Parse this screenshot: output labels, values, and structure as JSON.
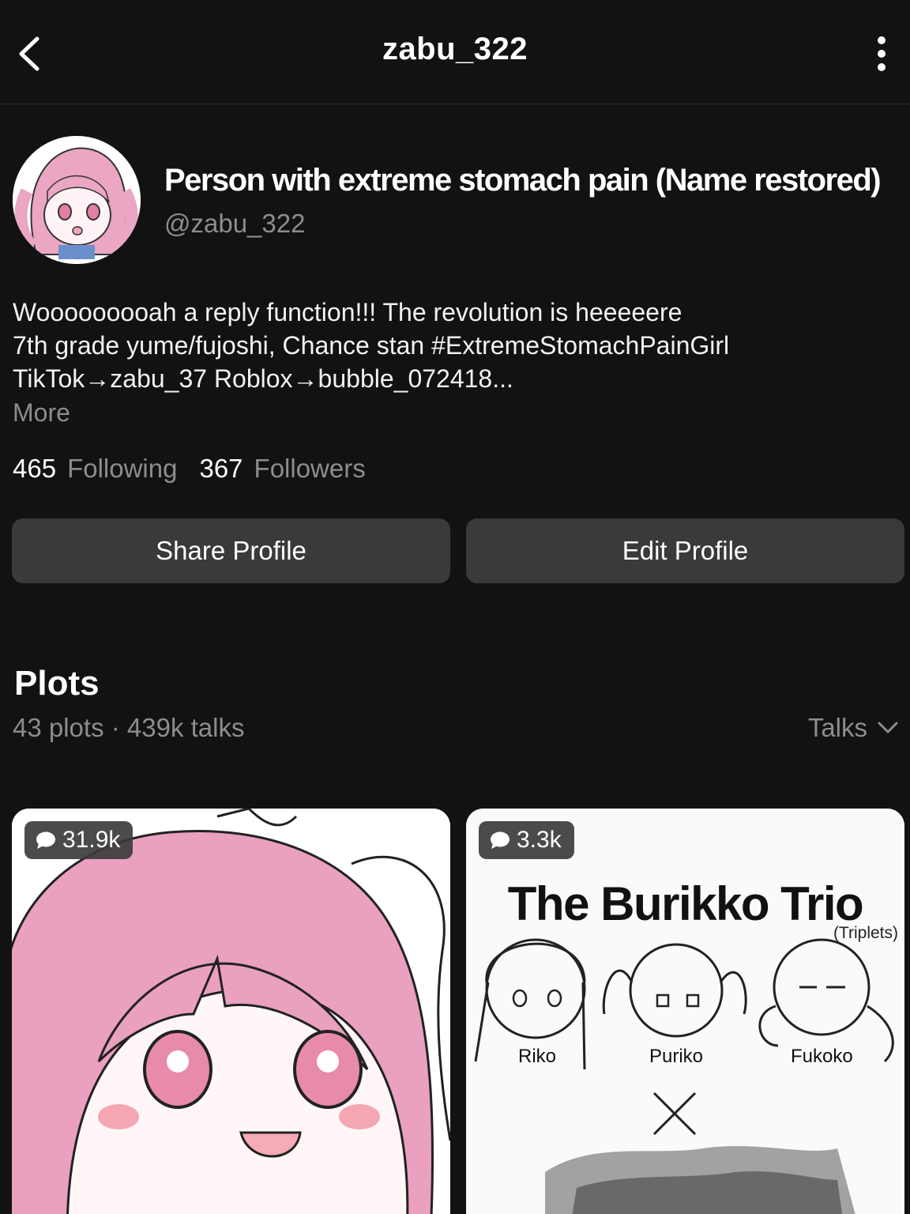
{
  "header": {
    "title": "zabu_322"
  },
  "profile": {
    "display_name": "Person with extreme stomach pain (Name restored)",
    "handle": "@zabu_322",
    "bio_lines": [
      "Wooooooooah a reply function!!! The revolution is heeeeere",
      "7th grade yume/fujoshi, Chance stan #ExtremeStomachPainGirl",
      "TikTok→zabu_37  Roblox→bubble_072418..."
    ],
    "more_label": "More",
    "stats": {
      "following_count": "465",
      "following_label": "Following",
      "followers_count": "367",
      "followers_label": "Followers"
    },
    "buttons": {
      "share": "Share Profile",
      "edit": "Edit Profile"
    }
  },
  "plots": {
    "title": "Plots",
    "meta": "43 plots · 439k talks",
    "sort_label": "Talks",
    "cards": [
      {
        "talks": "31.9k"
      },
      {
        "talks": "3.3k",
        "title": "The Burikko Trio",
        "subtitle": "(Triplets)",
        "characters": [
          "Riko",
          "Puriko",
          "Fukoko"
        ]
      }
    ]
  },
  "colors": {
    "background": "#121212",
    "button": "#3a3a3c",
    "muted_text": "#8d8d8d",
    "art_pink": "#e8a0bd"
  }
}
